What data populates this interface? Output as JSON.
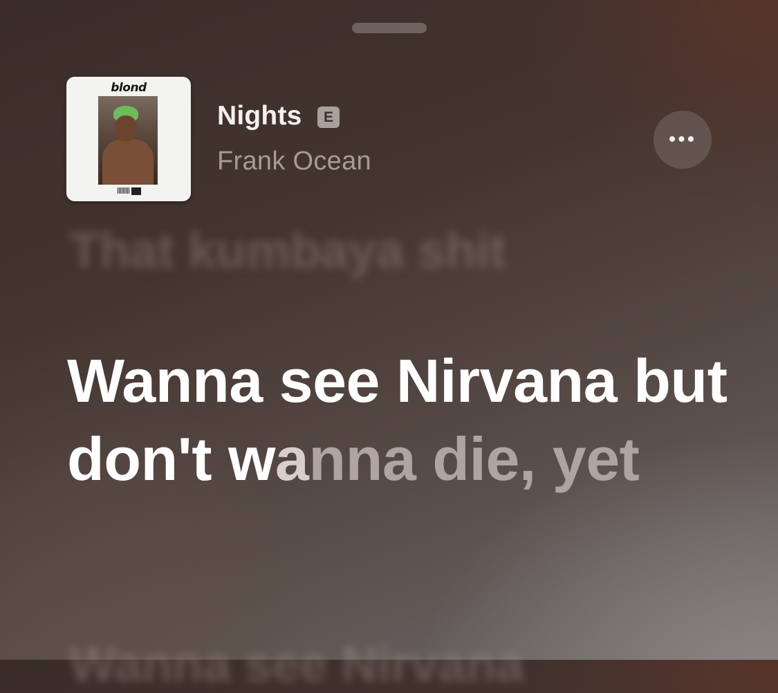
{
  "player": {
    "album": {
      "cover_title": "blond",
      "explicit": true
    },
    "track": {
      "title": "Nights",
      "explicit_badge": "E",
      "artist": "Frank Ocean"
    },
    "more_button_icon": "ellipsis-icon"
  },
  "lyrics": {
    "previous_line": "That kumbaya shit",
    "current_line": {
      "sung": "Wanna see Nirvana but don't w",
      "partial": "a",
      "unsung": "nna die, yet"
    },
    "next_line": "Wanna see Nirvana"
  },
  "colors": {
    "lyric_active": "#ffffff",
    "lyric_inactive": "#aea4a0",
    "artist_text": "#a49c98"
  }
}
